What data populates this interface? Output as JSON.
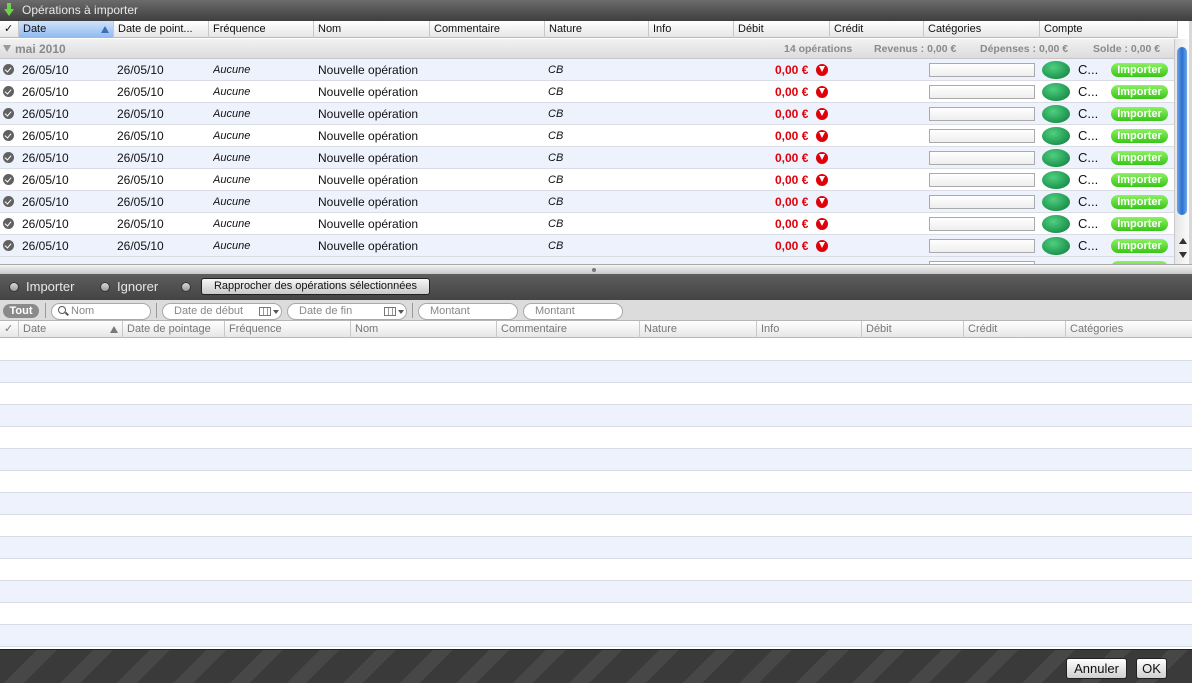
{
  "window": {
    "title": "Opérations à importer"
  },
  "top_table": {
    "columns": {
      "check": "✓",
      "date": "Date",
      "pointage": "Date de point...",
      "frequence": "Fréquence",
      "nom": "Nom",
      "commentaire": "Commentaire",
      "nature": "Nature",
      "info": "Info",
      "debit": "Débit",
      "credit": "Crédit",
      "categories": "Catégories",
      "compte": "Compte"
    },
    "group": {
      "name": "mai 2010",
      "count": "14 opérations",
      "revenus": "Revenus : 0,00 €",
      "depenses": "Dépenses : 0,00 €",
      "solde": "Solde : 0,00 €"
    },
    "rows": [
      {
        "date": "26/05/10",
        "pointage": "26/05/10",
        "frequence": "Aucune",
        "nom": "Nouvelle opération",
        "nature": "CB",
        "debit": "0,00 €",
        "compte": "C...",
        "action": "Importer"
      },
      {
        "date": "26/05/10",
        "pointage": "26/05/10",
        "frequence": "Aucune",
        "nom": "Nouvelle opération",
        "nature": "CB",
        "debit": "0,00 €",
        "compte": "C...",
        "action": "Importer"
      },
      {
        "date": "26/05/10",
        "pointage": "26/05/10",
        "frequence": "Aucune",
        "nom": "Nouvelle opération",
        "nature": "CB",
        "debit": "0,00 €",
        "compte": "C...",
        "action": "Importer"
      },
      {
        "date": "26/05/10",
        "pointage": "26/05/10",
        "frequence": "Aucune",
        "nom": "Nouvelle opération",
        "nature": "CB",
        "debit": "0,00 €",
        "compte": "C...",
        "action": "Importer"
      },
      {
        "date": "26/05/10",
        "pointage": "26/05/10",
        "frequence": "Aucune",
        "nom": "Nouvelle opération",
        "nature": "CB",
        "debit": "0,00 €",
        "compte": "C...",
        "action": "Importer"
      },
      {
        "date": "26/05/10",
        "pointage": "26/05/10",
        "frequence": "Aucune",
        "nom": "Nouvelle opération",
        "nature": "CB",
        "debit": "0,00 €",
        "compte": "C...",
        "action": "Importer"
      },
      {
        "date": "26/05/10",
        "pointage": "26/05/10",
        "frequence": "Aucune",
        "nom": "Nouvelle opération",
        "nature": "CB",
        "debit": "0,00 €",
        "compte": "C...",
        "action": "Importer"
      },
      {
        "date": "26/05/10",
        "pointage": "26/05/10",
        "frequence": "Aucune",
        "nom": "Nouvelle opération",
        "nature": "CB",
        "debit": "0,00 €",
        "compte": "C...",
        "action": "Importer"
      },
      {
        "date": "26/05/10",
        "pointage": "26/05/10",
        "frequence": "Aucune",
        "nom": "Nouvelle opération",
        "nature": "CB",
        "debit": "0,00 €",
        "compte": "C...",
        "action": "Importer"
      }
    ]
  },
  "action_bar": {
    "importer": "Importer",
    "ignorer": "Ignorer",
    "rapprocher": "Rapprocher des opérations sélectionnées"
  },
  "filters": {
    "tout": "Tout",
    "nom_placeholder": "Nom",
    "date_debut_placeholder": "Date de début",
    "date_fin_placeholder": "Date de fin",
    "montant_min_placeholder": "Montant",
    "montant_max_placeholder": "Montant"
  },
  "bottom_table": {
    "columns": {
      "check": "✓",
      "date": "Date",
      "pointage": "Date de pointage",
      "frequence": "Fréquence",
      "nom": "Nom",
      "commentaire": "Commentaire",
      "nature": "Nature",
      "info": "Info",
      "debit": "Débit",
      "credit": "Crédit",
      "categories": "Catégories"
    }
  },
  "buttons": {
    "annuler": "Annuler",
    "ok": "OK"
  },
  "colors": {
    "debit_red": "#e0000a",
    "import_green": "#39c617",
    "selection_blue": "#2d6ed0"
  },
  "icons": {
    "title": "down-arrow-icon",
    "row_status": "check-circle-icon",
    "debit": "down-arrow-circle-icon",
    "bank": "bank-logo-icon"
  }
}
